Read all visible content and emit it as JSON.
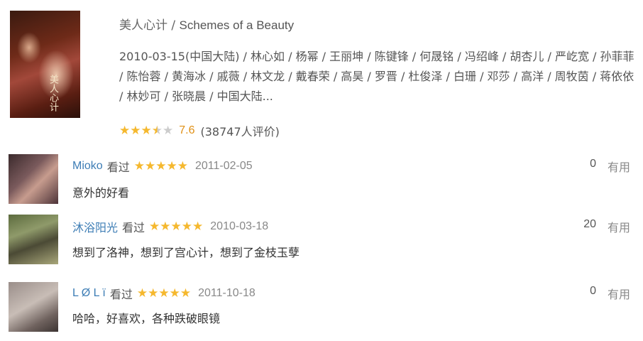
{
  "movie": {
    "title_cn": "美人心计",
    "title_sep": " / ",
    "title_en": "Schemes of a Beauty",
    "poster_text": "美人心计",
    "meta": "2010-03-15(中国大陆) / 林心如 / 杨幂 / 王丽坤 / 陈键锋 / 何晟铭 / 冯绍峰 / 胡杏儿 / 严屹宽 / 孙菲菲 / 陈怡蓉 / 黄海冰 / 戚薇 / 林文龙 / 戴春荣 / 高昊 / 罗晋 / 杜俊泽 / 白珊 / 邓莎 / 高洋 / 周牧茵 / 蒋依依 / 林妙可 / 张晓晨 / 中国大陆...",
    "score": "7.6",
    "rating_count": "(38747人评价)",
    "stars": 3.5
  },
  "comments": [
    {
      "user": "Mioko",
      "saw": "看过",
      "date": "2011-02-05",
      "votes": "0",
      "useful": "有用",
      "text": "意外的好看",
      "stars": 5
    },
    {
      "user": "沐浴阳光",
      "saw": "看过",
      "date": "2010-03-18",
      "votes": "20",
      "useful": "有用",
      "text": "想到了洛神，想到了宫心计，想到了金枝玉孽",
      "stars": 5
    },
    {
      "user": "L Ø L ï",
      "saw": "看过",
      "date": "2011-10-18",
      "votes": "0",
      "useful": "有用",
      "text": "哈哈，好喜欢，各种跌破眼镜",
      "stars": 5
    }
  ],
  "colors": {
    "star": "#f5b82e",
    "score": "#e09015",
    "username": "#3d7db5"
  }
}
